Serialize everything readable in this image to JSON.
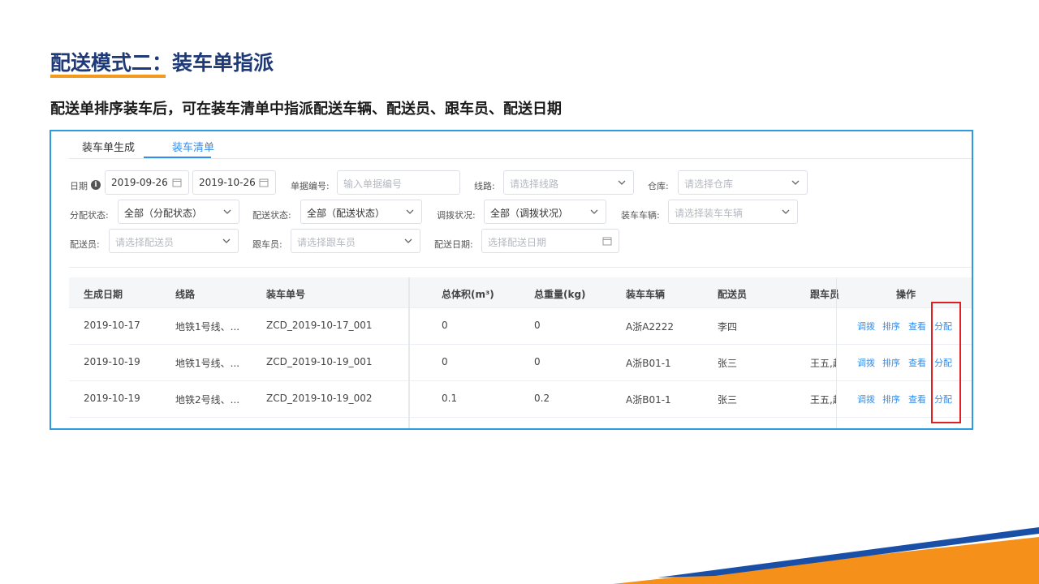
{
  "slide": {
    "title": "配送模式二：装车单指派",
    "subtitle": "配送单排序装车后，可在装车清单中指派配送车辆、配送员、跟车员、配送日期"
  },
  "tabs": [
    {
      "label": "装车单生成",
      "active": false
    },
    {
      "label": "装车清单",
      "active": true
    }
  ],
  "filters": {
    "date": {
      "label": "日期",
      "start": "2019-09-26",
      "end": "2019-10-26"
    },
    "doc_no": {
      "label": "单据编号:",
      "placeholder": "输入单据编号"
    },
    "route": {
      "label": "线路:",
      "placeholder": "请选择线路"
    },
    "warehouse": {
      "label": "仓库:",
      "placeholder": "请选择仓库"
    },
    "assign_status": {
      "label": "分配状态:",
      "value": "全部（分配状态）"
    },
    "delivery_status": {
      "label": "配送状态:",
      "value": "全部（配送状态）"
    },
    "transfer_status": {
      "label": "调拨状况:",
      "value": "全部（调拨状况）"
    },
    "vehicle": {
      "label": "装车车辆:",
      "placeholder": "请选择装车车辆"
    },
    "courier": {
      "label": "配送员:",
      "placeholder": "请选择配送员"
    },
    "escort": {
      "label": "跟车员:",
      "placeholder": "请选择跟车员"
    },
    "delivery_date": {
      "label": "配送日期:",
      "placeholder": "选择配送日期"
    }
  },
  "table": {
    "headers": [
      "生成日期",
      "线路",
      "装车单号",
      "总体积(m³)",
      "总重量(kg)",
      "装车车辆",
      "配送员",
      "跟车员",
      "操作"
    ],
    "rows": [
      {
        "date": "2019-10-17",
        "route": "地铁1号线、...",
        "no": "ZCD_2019-10-17_001",
        "volume": "0",
        "weight": "0",
        "vehicle": "A浙A2222",
        "courier": "李四",
        "escort": ""
      },
      {
        "date": "2019-10-19",
        "route": "地铁1号线、...",
        "no": "ZCD_2019-10-19_001",
        "volume": "0",
        "weight": "0",
        "vehicle": "A浙B01-1",
        "courier": "张三",
        "escort": "王五,赵"
      },
      {
        "date": "2019-10-19",
        "route": "地铁2号线、...",
        "no": "ZCD_2019-10-19_002",
        "volume": "0.1",
        "weight": "0.2",
        "vehicle": "A浙B01-1",
        "courier": "张三",
        "escort": "王五,赵"
      }
    ],
    "actions": [
      "调拨",
      "排序",
      "查看",
      "分配"
    ]
  },
  "colors": {
    "title": "#1f3a78",
    "accent_orange": "#f39a1e",
    "frame_border": "#2d9be0",
    "link_blue": "#2f8ef0",
    "highlight_red": "#e02020",
    "stripe_blue": "#1a4fa8"
  }
}
